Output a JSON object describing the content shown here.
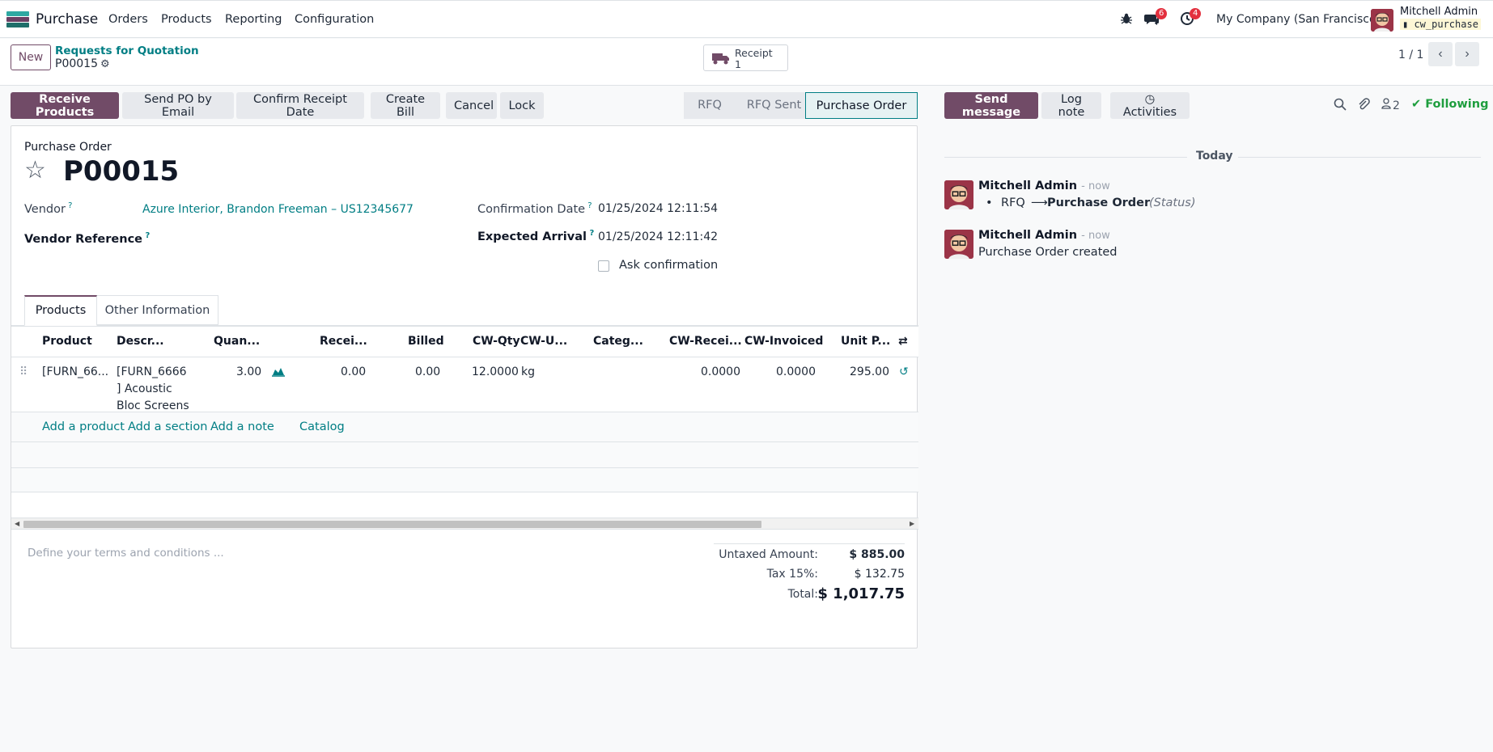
{
  "nav": {
    "app_name": "Purchase",
    "menu": [
      "Orders",
      "Products",
      "Reporting",
      "Configuration"
    ],
    "chat_badge": "6",
    "activity_badge": "4",
    "company": "My Company (San Francisco)",
    "user_name": "Mitchell Admin",
    "database": "cw_purchase"
  },
  "control": {
    "new_label": "New",
    "breadcrumb_parent": "Requests for Quotation",
    "breadcrumb_current": "P00015",
    "receipt_label": "Receipt",
    "receipt_count": "1",
    "pager": "1 / 1"
  },
  "actions": {
    "receive": "Receive Products",
    "send_email": "Send PO by Email",
    "confirm_receipt": "Confirm Receipt Date",
    "create_bill": "Create Bill",
    "cancel": "Cancel",
    "lock": "Lock"
  },
  "stages": [
    "RFQ",
    "RFQ Sent",
    "Purchase Order"
  ],
  "form": {
    "type_label": "Purchase Order",
    "name": "P00015",
    "vendor_label": "Vendor",
    "vendor_value": "Azure Interior, Brandon Freeman – US12345677",
    "vendor_ref_label": "Vendor Reference",
    "confirmation_label": "Confirmation Date",
    "confirmation_value": "01/25/2024 12:11:54",
    "expected_label": "Expected Arrival",
    "expected_value": "01/25/2024 12:11:42",
    "ask_confirmation": "Ask confirmation",
    "tab_products": "Products",
    "tab_other": "Other Information"
  },
  "table": {
    "headers": [
      "Product",
      "Descr...",
      "Quan...",
      "Recei...",
      "Billed",
      "CW-Qty",
      "CW-U...",
      "Categ...",
      "CW-Recei...",
      "CW-Invoiced",
      "Unit P..."
    ],
    "row": {
      "product": "[FURN_66...",
      "description_1": "[FURN_6666",
      "description_2": "] Acoustic",
      "description_3": "Bloc Screens",
      "quantity": "3.00",
      "received": "0.00",
      "billed": "0.00",
      "cw_qty": "12.0000",
      "cw_uom": "kg",
      "cw_received": "0.0000",
      "cw_invoiced": "0.0000",
      "unit_price": "295.00"
    },
    "add_product": "Add a product",
    "add_section": "Add a section",
    "add_note": "Add a note",
    "catalog": "Catalog"
  },
  "terms_placeholder": "Define your terms and conditions ...",
  "totals": {
    "untaxed_label": "Untaxed Amount:",
    "untaxed_value": "$ 885.00",
    "tax_label": "Tax 15%:",
    "tax_value": "$ 132.75",
    "total_label": "Total:",
    "total_value": "$ 1,017.75"
  },
  "chatter": {
    "send_message": "Send message",
    "log_note": "Log note",
    "activities": "Activities",
    "followers_count": "2",
    "following": "Following",
    "today": "Today",
    "msg1_author": "Mitchell Admin",
    "msg1_time": "- now",
    "msg1_from": "RFQ",
    "msg1_to": "Purchase Order",
    "msg1_field": "(Status)",
    "msg2_author": "Mitchell Admin",
    "msg2_time": "- now",
    "msg2_body": "Purchase Order created"
  },
  "colors": {
    "primary": "#714b67",
    "link": "#017e84",
    "badge": "#e3303e",
    "following": "#1e9e3e"
  }
}
